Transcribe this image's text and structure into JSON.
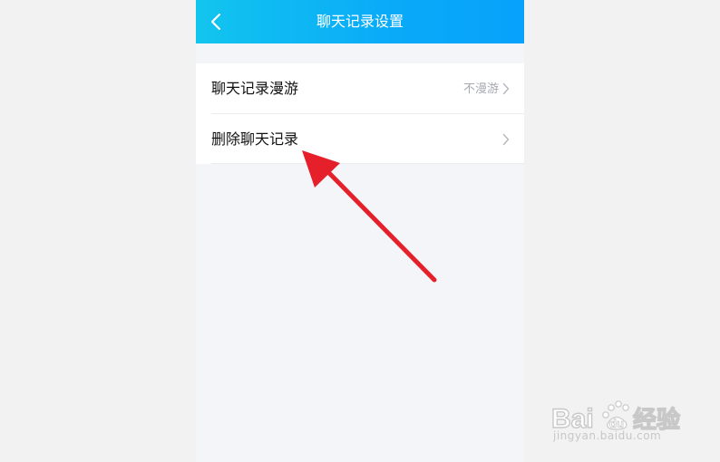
{
  "header": {
    "title": "聊天记录设置",
    "back_icon": "chevron-left-icon"
  },
  "settings": {
    "items": [
      {
        "label": "聊天记录漫游",
        "value": "不漫游",
        "icon": "chevron-right-icon"
      },
      {
        "label": "删除聊天记录",
        "value": "",
        "icon": "chevron-right-icon"
      }
    ]
  },
  "annotation": {
    "type": "arrow",
    "color": "#e5202a",
    "points_to": "删除聊天记录"
  },
  "watermark": {
    "brand": "Bai du 经验",
    "url": "jingyan.baidu.com"
  },
  "colors": {
    "header_gradient_start": "#12c5ee",
    "header_gradient_end": "#06a2fb",
    "page_background": "#f4f5f8",
    "list_background": "#ffffff"
  }
}
